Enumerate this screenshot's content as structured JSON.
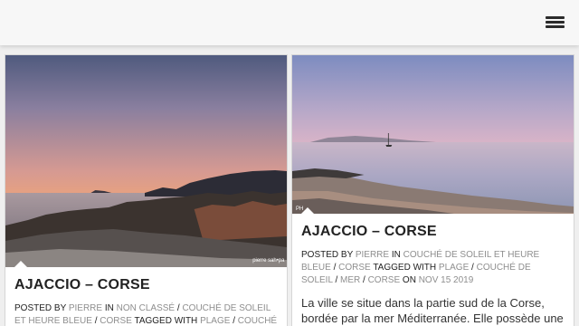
{
  "header": {
    "menu_icon": "hamburger-menu-icon"
  },
  "posts": [
    {
      "title": "AJACCIO – CORSE",
      "posted_by_label": "POSTED BY",
      "author": "PIERRE",
      "in_label": "IN",
      "cat1": "NON CLASSÉ",
      "sep": "/",
      "cat2": "COUCHÉ DE SOLEIL ET HEURE BLEUE",
      "cat3": "CORSE",
      "tagged_label": "TAGGED WITH",
      "tag1": "PLAGE",
      "tag2": "COUCHÉ",
      "watermark": "pierre sah•pa"
    },
    {
      "title": "AJACCIO – CORSE",
      "posted_by_label": "POSTED BY",
      "author": "PIERRE",
      "in_label": "IN",
      "cat1": "COUCHÉ DE SOLEIL ET HEURE BLEUE",
      "sep": "/",
      "cat2": "CORSE",
      "tagged_label": "TAGGED WITH",
      "tag1": "PLAGE",
      "tag2": "COUCHÉ DE SOLEIL",
      "tag3": "MER",
      "tag4": "CORSE",
      "on_label": "ON",
      "date": "NOV 15 2019",
      "excerpt": "La ville se situe dans la partie sud de la Corse, bordée par la mer Méditerranée. Elle possède une",
      "watermark": "PH"
    }
  ],
  "colors": {
    "background": "#efefef",
    "card": "#ffffff",
    "link": "#8e8e8e",
    "text": "#222222"
  }
}
